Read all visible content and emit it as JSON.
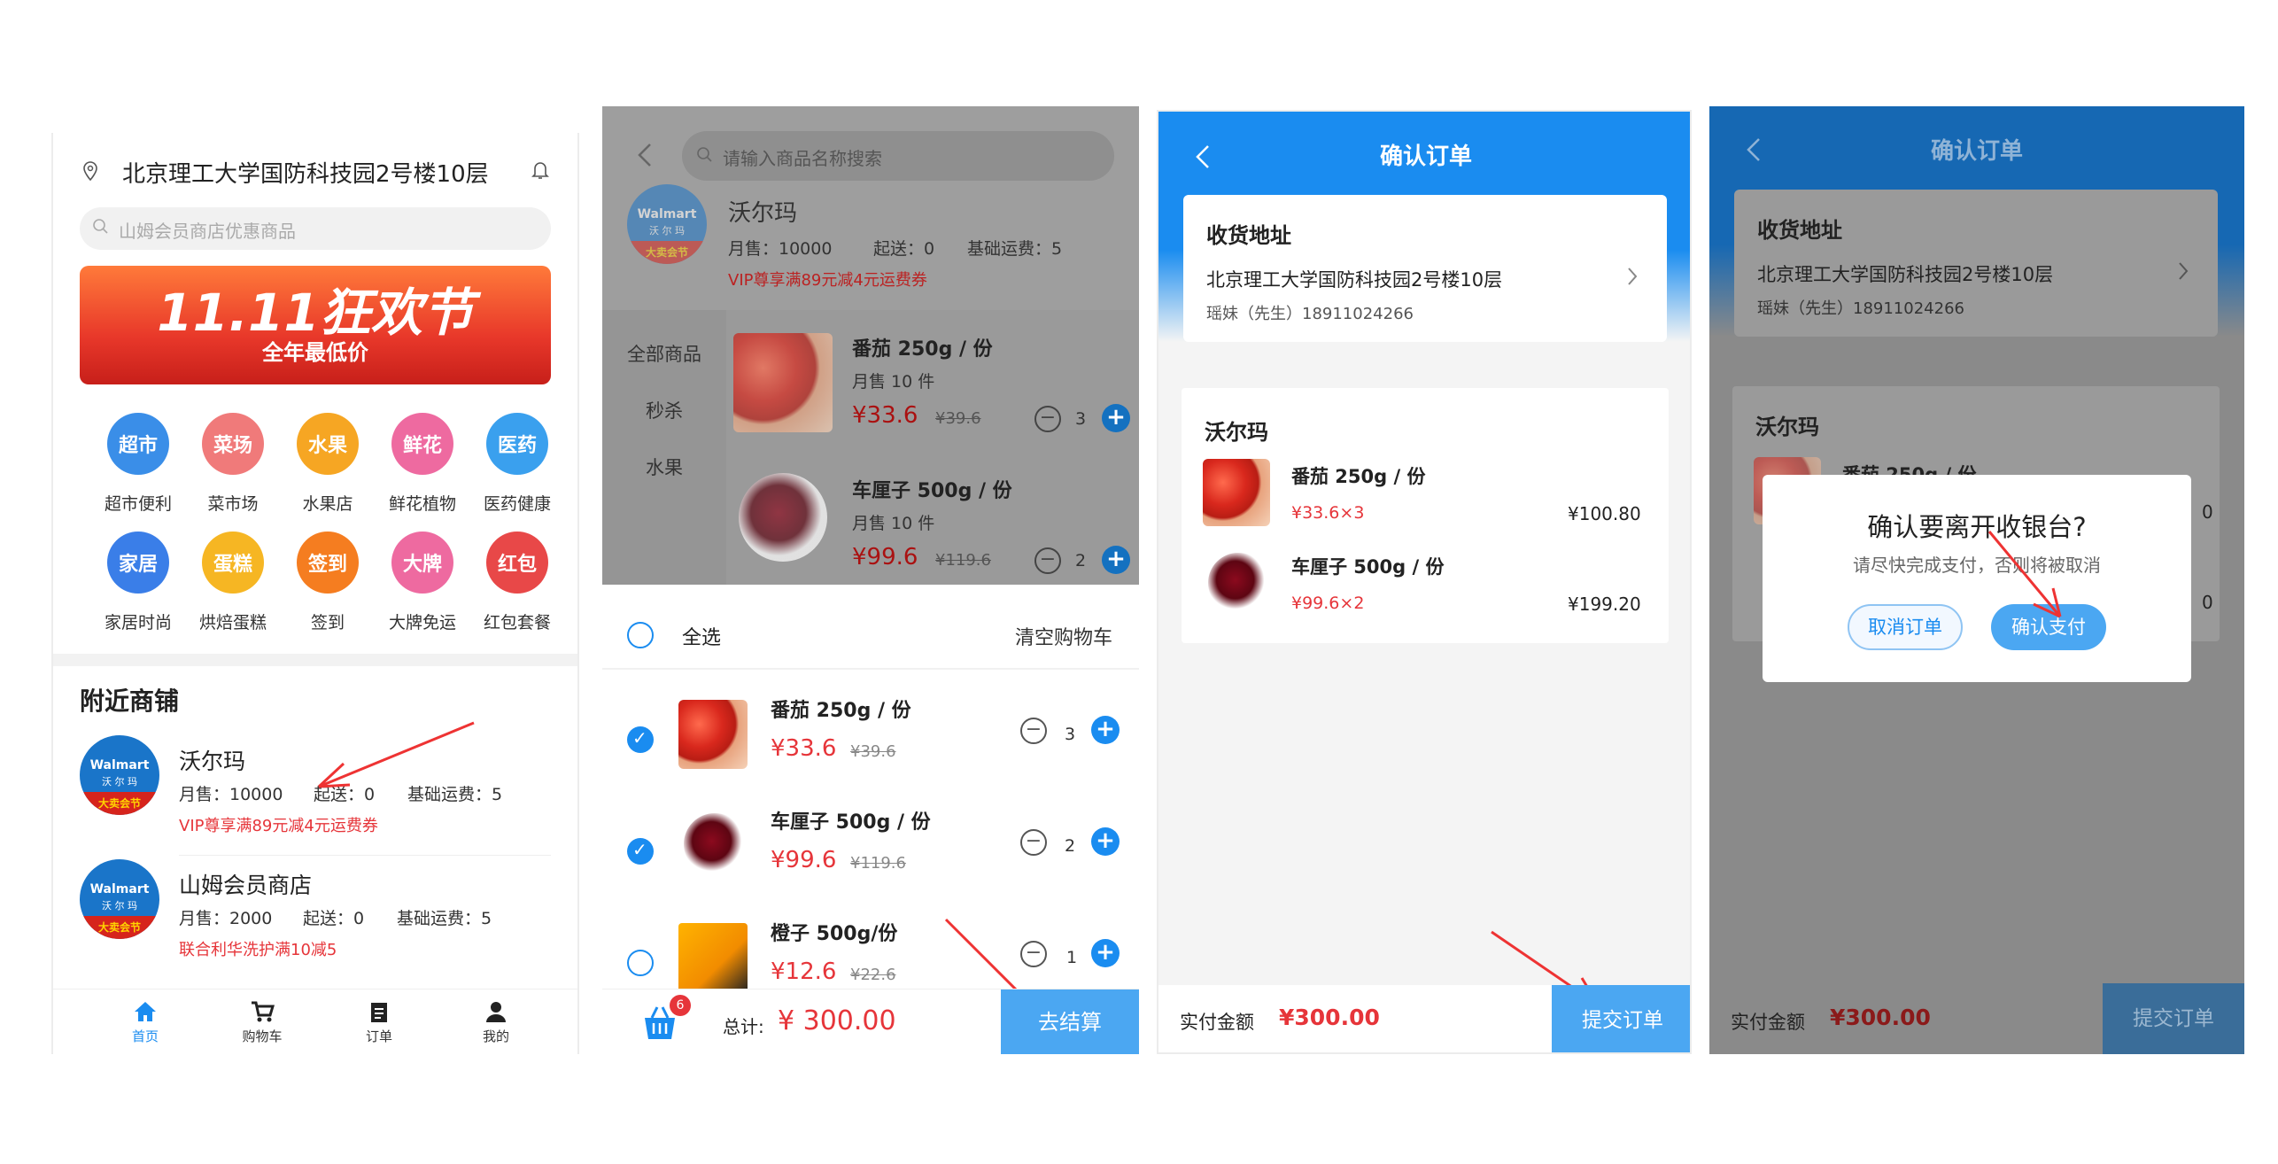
{
  "screen1": {
    "address": "北京理工大学国防科技园2号楼10层",
    "search_placeholder": "山姆会员商店优惠商品",
    "banner_title": "11.11狂欢节",
    "banner_subtitle": "全年最低价",
    "categories": [
      {
        "icon": "超市",
        "label": "超市便利",
        "color": "#3a8ee8"
      },
      {
        "icon": "菜场",
        "label": "菜市场",
        "color": "#f07a7a"
      },
      {
        "icon": "水果",
        "label": "水果店",
        "color": "#f6a623"
      },
      {
        "icon": "鲜花",
        "label": "鲜花植物",
        "color": "#ee6aa0"
      },
      {
        "icon": "医药",
        "label": "医药健康",
        "color": "#3aa0ee"
      },
      {
        "icon": "家居",
        "label": "家居时尚",
        "color": "#3a7ee8"
      },
      {
        "icon": "蛋糕",
        "label": "烘焙蛋糕",
        "color": "#f6b623"
      },
      {
        "icon": "签到",
        "label": "签到",
        "color": "#f57d20"
      },
      {
        "icon": "大牌",
        "label": "大牌免运",
        "color": "#ee6aa0"
      },
      {
        "icon": "红包",
        "label": "红包套餐",
        "color": "#e84848"
      }
    ],
    "nearby_title": "附近商铺",
    "stores": [
      {
        "name": "沃尔玛",
        "monthly": "月售：10000",
        "min": "起送：0",
        "fee": "基础运费：5",
        "promo": "VIP尊享满89元减4元运费券"
      },
      {
        "name": "山姆会员商店",
        "monthly": "月售：2000",
        "min": "起送：0",
        "fee": "基础运费：5",
        "promo": "联合利华洗护满10减5"
      }
    ],
    "walmart_logo": "Walmart",
    "walmart_logo_cn": "沃 尔 玛",
    "walmart_logo_band": "大卖会节",
    "tabs": [
      "首页",
      "购物车",
      "订单",
      "我的"
    ]
  },
  "screen2": {
    "search_placeholder": "请输入商品名称搜索",
    "store_name": "沃尔玛",
    "monthly": "月售：10000",
    "min": "起送：0",
    "fee": "基础运费：5",
    "promo": "VIP尊享满89元减4元运费券",
    "side_menu": [
      "全部商品",
      "秒杀",
      "水果"
    ],
    "products": [
      {
        "name": "番茄 250g / 份",
        "sales": "月售 10 件",
        "price": "¥33.6",
        "old": "¥39.6",
        "qty": "3"
      },
      {
        "name": "车厘子 500g / 份",
        "sales": "月售 10 件",
        "price": "¥99.6",
        "old": "¥119.6",
        "qty": "2"
      }
    ],
    "select_all": "全选",
    "clear_cart": "清空购物车",
    "cart_items": [
      {
        "name": "番茄 250g / 份",
        "price": "¥33.6",
        "old": "¥39.6",
        "qty": "3"
      },
      {
        "name": "车厘子 500g / 份",
        "price": "¥99.6",
        "old": "¥119.6",
        "qty": "2"
      },
      {
        "name": "橙子 500g/份",
        "price": "¥12.6",
        "old": "¥22.6",
        "qty": "1"
      }
    ],
    "badge": "6",
    "total_label": "总计:",
    "total": "¥ 300.00",
    "checkout": "去结算"
  },
  "screen3": {
    "title": "确认订单",
    "address_title": "收货地址",
    "address": "北京理工大学国防科技园2号楼10层",
    "contact": "瑶妹（先生）18911024266",
    "store": "沃尔玛",
    "items": [
      {
        "name": "番茄 250g / 份",
        "price": "¥33.6×3",
        "sum": "¥100.80"
      },
      {
        "name": "车厘子 500g / 份",
        "price": "¥99.6×2",
        "sum": "¥199.20"
      }
    ],
    "pay_label": "实付金额",
    "pay_amount": "¥300.00",
    "submit": "提交订单"
  },
  "screen4": {
    "dialog_title": "确认要离开收银台?",
    "dialog_msg": "请尽快完成支付，否则将被取消",
    "cancel": "取消订单",
    "confirm": "确认支付",
    "partial_right_1": "0",
    "partial_right_2": "0"
  }
}
